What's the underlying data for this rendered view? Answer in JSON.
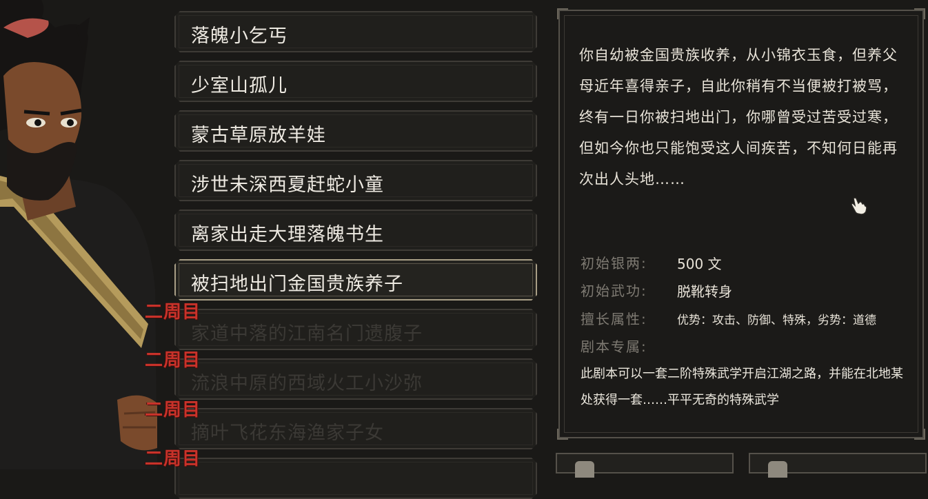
{
  "backgrounds": [
    {
      "label": "落魄小乞丐",
      "state": "normal"
    },
    {
      "label": "少室山孤儿",
      "state": "normal"
    },
    {
      "label": "蒙古草原放羊娃",
      "state": "normal"
    },
    {
      "label": "涉世未深西夏赶蛇小童",
      "state": "normal"
    },
    {
      "label": "离家出走大理落魄书生",
      "state": "normal"
    },
    {
      "label": "被扫地出门金国贵族养子",
      "state": "selected"
    },
    {
      "label": "家道中落的江南名门遗腹子",
      "state": "locked",
      "badge": "二周目"
    },
    {
      "label": "流浪中原的西域火工小沙弥",
      "state": "locked",
      "badge": "二周目"
    },
    {
      "label": "摘叶飞花东海渔家子女",
      "state": "locked",
      "badge": "二周目"
    },
    {
      "label": "",
      "state": "locked",
      "badge": "二周目"
    }
  ],
  "detail": {
    "description": "你自幼被金国贵族收养，从小锦衣玉食，但养父母近年喜得亲子，自此你稍有不当便被打被骂，终有一日你被扫地出门，你哪曾受过苦受过寒，但如今你也只能饱受这人间疾苦，不知何日能再次出人头地……",
    "silver_label": "初始银两:",
    "silver_value": "500 文",
    "skill_label": "初始武功:",
    "skill_value": "脱靴转身",
    "attr_label": "擅长属性:",
    "attr_value": "优势：攻击、防御、特殊，劣势：道德",
    "exclusive_label": "剧本专属:",
    "exclusive_text": "此剧本可以一套二阶特殊武学开启江湖之路，并能在北地某处获得一套……平平无奇的特殊武学"
  },
  "colors": {
    "background": "#1a1917",
    "text": "#eeeae2",
    "badge": "#c8322a",
    "selected_border": "#a89e86"
  },
  "icons": {
    "cursor": "hand-pointer-icon"
  }
}
